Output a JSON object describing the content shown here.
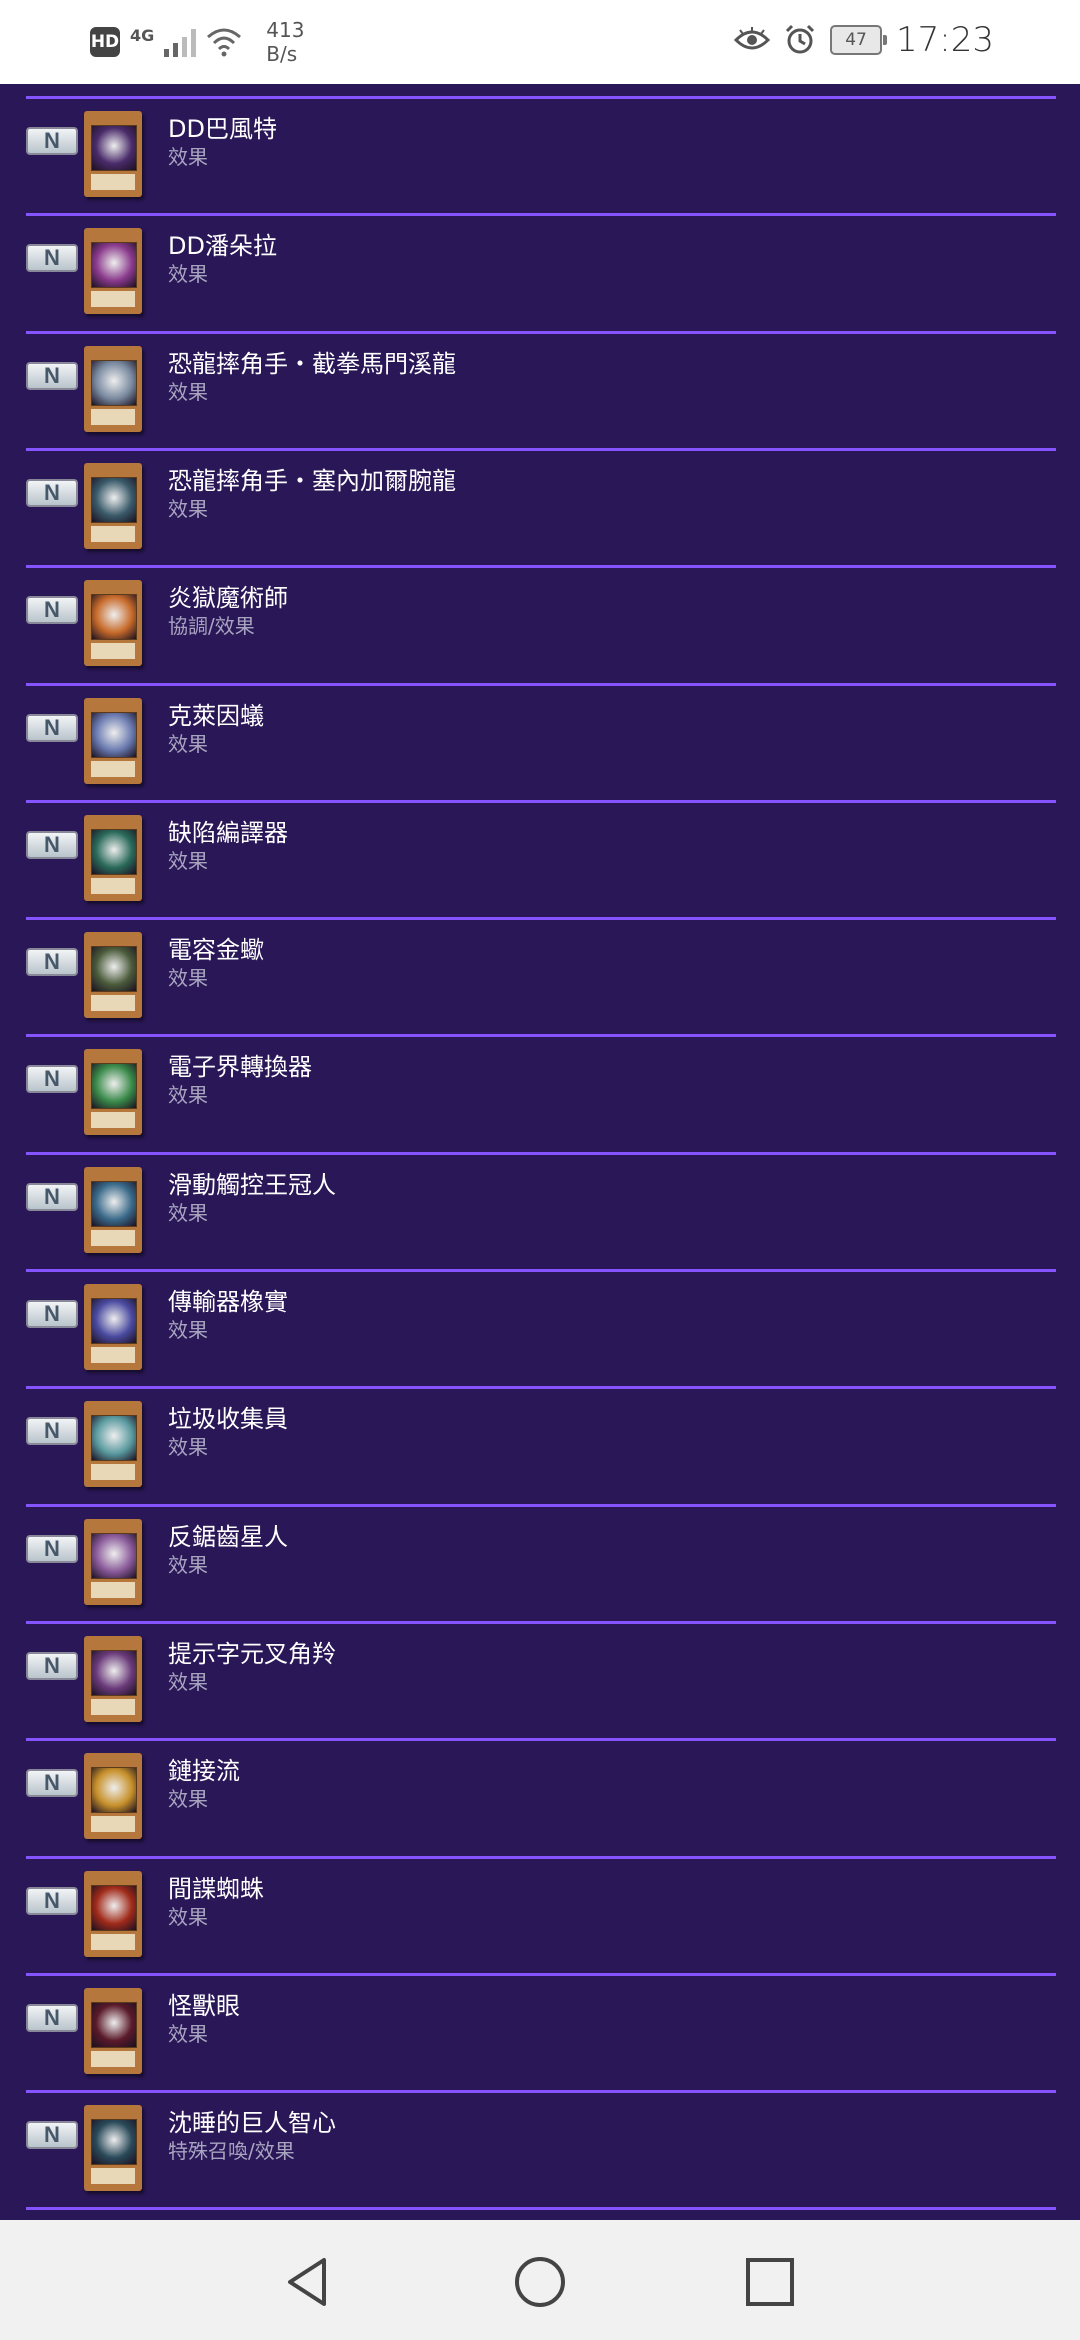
{
  "status_bar": {
    "hd": "HD",
    "network": "4G",
    "speed_value": "413",
    "speed_unit": "B/s",
    "battery": "47",
    "time": "17:23"
  },
  "rows": [
    {
      "rarity": "N",
      "name": "DD巴風特",
      "type": "效果",
      "art_color": "#4a2b6a"
    },
    {
      "rarity": "N",
      "name": "DD潘朵拉",
      "type": "效果",
      "art_color": "#8a3a8c"
    },
    {
      "rarity": "N",
      "name": "恐龍摔角手・截拳馬門溪龍",
      "type": "效果",
      "art_color": "#7a8aa0"
    },
    {
      "rarity": "N",
      "name": "恐龍摔角手・塞內加爾腕龍",
      "type": "效果",
      "art_color": "#3a5a6a"
    },
    {
      "rarity": "N",
      "name": "炎獄魔術師",
      "type": "協調/效果",
      "art_color": "#c76a2a"
    },
    {
      "rarity": "N",
      "name": "克萊因蟻",
      "type": "效果",
      "art_color": "#6a7ab0"
    },
    {
      "rarity": "N",
      "name": "缺陷編譯器",
      "type": "效果",
      "art_color": "#2a6a5a"
    },
    {
      "rarity": "N",
      "name": "電容金蠍",
      "type": "效果",
      "art_color": "#4a5a3a"
    },
    {
      "rarity": "N",
      "name": "電子界轉換器",
      "type": "效果",
      "art_color": "#3a8a4a"
    },
    {
      "rarity": "N",
      "name": "滑動觸控王冠人",
      "type": "效果",
      "art_color": "#3a6a8a"
    },
    {
      "rarity": "N",
      "name": "傳輸器橡實",
      "type": "效果",
      "art_color": "#4a4aa0"
    },
    {
      "rarity": "N",
      "name": "垃圾收集員",
      "type": "效果",
      "art_color": "#5a9aa0"
    },
    {
      "rarity": "N",
      "name": "反鋸齒星人",
      "type": "效果",
      "art_color": "#8a5a9a"
    },
    {
      "rarity": "N",
      "name": "提示字元叉角羚",
      "type": "效果",
      "art_color": "#6a3a7a"
    },
    {
      "rarity": "N",
      "name": "鏈接流",
      "type": "效果",
      "art_color": "#c7902a"
    },
    {
      "rarity": "N",
      "name": "間諜蜘蛛",
      "type": "效果",
      "art_color": "#a02a1a"
    },
    {
      "rarity": "N",
      "name": "怪獸眼",
      "type": "效果",
      "art_color": "#5a1a2a"
    },
    {
      "rarity": "N",
      "name": "沈睡的巨人智心",
      "type": "特殊召喚/效果",
      "art_color": "#2a4a5a"
    }
  ],
  "nav": {
    "back_icon": "back-triangle-icon",
    "home_icon": "home-circle-icon",
    "recent_icon": "recent-square-icon"
  }
}
